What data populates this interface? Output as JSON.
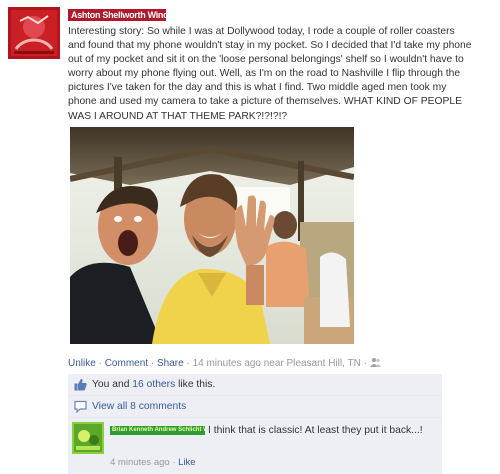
{
  "post": {
    "author": "Ashton Shellworth Wind",
    "text": "Interesting story: So while I was at Dollywood today, I rode a couple of roller coasters and found that my phone wouldn't stay in my pocket. So I decided that I'd take my phone out of my pocket and sit it on the 'loose personal belongings' shelf so I wouldn't have to worry about my phone flying out. Well, as I'm on the road to Nashville I flip through the pictures I've taken for the day and this is what I find. Two middle aged men took my phone and used my camera to take a picture of themselves. WHAT KIND OF PEOPLE WAS I AROUND AT THAT THEME PARK?!?!?!?"
  },
  "actions": {
    "unlike": "Unlike",
    "comment": "Comment",
    "share": "Share",
    "sep": "·",
    "time": "14 minutes ago near",
    "place": "Pleasant Hill, TN",
    "audience_icon": "friends-icon"
  },
  "likes": {
    "icon": "thumbs-up-icon",
    "prefix": "You and",
    "others": "16 others",
    "suffix": "like this."
  },
  "comments_link": {
    "icon": "speech-bubble-icon",
    "label": "View all 8 comments"
  },
  "comment": {
    "author": "Brian Kenneth Andrew Schlicht Wiener",
    "text": "I think that is classic! At least they put it back...!",
    "time": "4 minutes ago",
    "like": "Like"
  },
  "colors": {
    "link": "#3b5998",
    "meta": "#999999",
    "ufi_bg": "#edeff4",
    "author_badge": "#b1182a",
    "comment_badge": "#2f9c36"
  }
}
